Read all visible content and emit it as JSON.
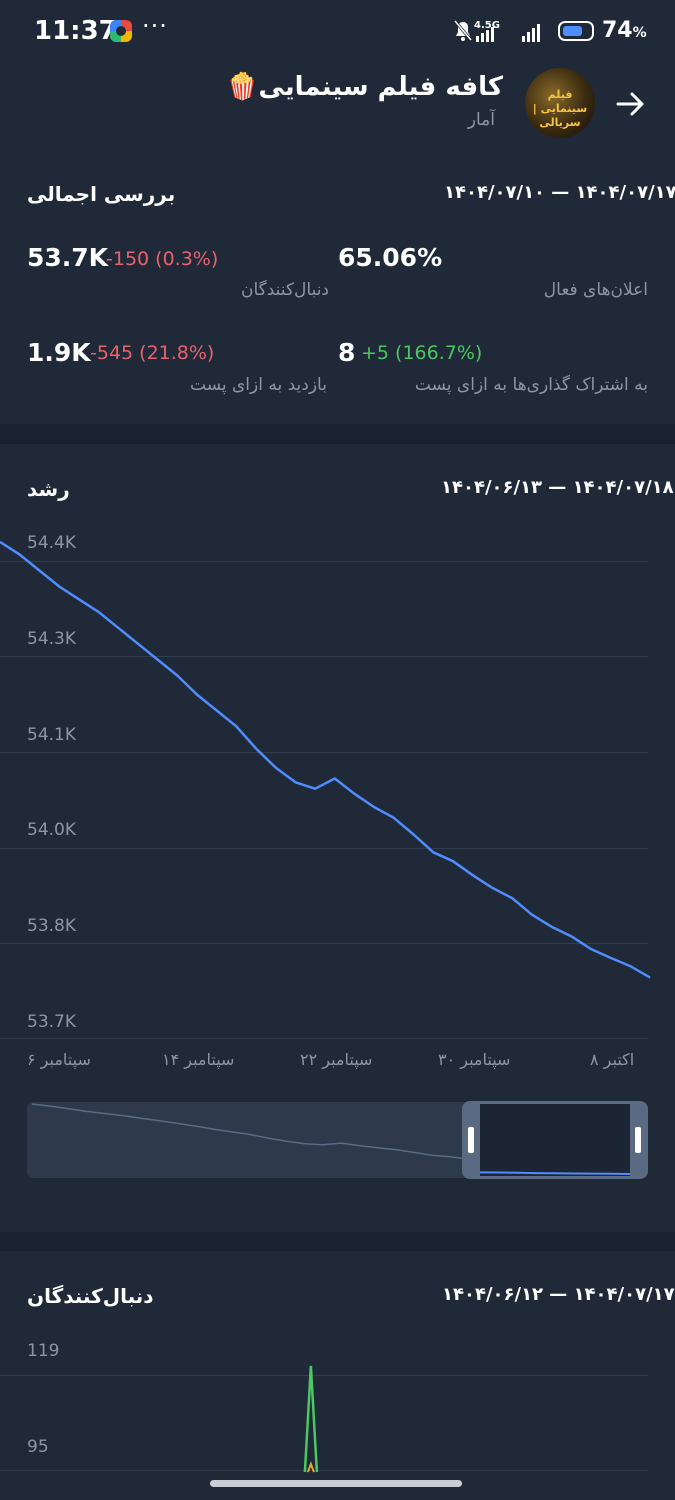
{
  "status_bar": {
    "time": "11:37",
    "dots": "···",
    "network": "4.5G",
    "battery_percent": "74",
    "battery_suffix": "%",
    "battery_level": 0.74
  },
  "header": {
    "channel_name": "کافه فیلم سینمایی",
    "channel_emoji": "🍿",
    "subtitle": "آمار",
    "avatar_text": "فیلم سینمایی | سریالی",
    "icons": [
      "back-arrow-icon"
    ]
  },
  "overview": {
    "title": "بررسی اجمالی",
    "date_range": "۱۴۰۴/۰۷/۱۰ — ۱۴۰۴/۰۷/۱۷",
    "followers": {
      "value": "53.7K",
      "delta": "-150 (0.3%)",
      "label": "دنبال‌کنندگان"
    },
    "notifications": {
      "value": "65.06%",
      "label": "اعلان‌های فعال"
    },
    "views_per_post": {
      "value": "1.9K",
      "delta": "-545 (21.8%)",
      "label": "بازدید به ازای پست"
    },
    "shares_per_post": {
      "value": "8",
      "delta": "+5 (166.7%)",
      "label": "به اشتراک گذاری‌ها به ازای پست"
    }
  },
  "growth": {
    "title": "رشد",
    "date_range": "۱۴۰۴/۰۶/۱۳ — ۱۴۰۴/۰۷/۱۸",
    "y_ticks": [
      "54.4K",
      "54.3K",
      "54.1K",
      "54.0K",
      "53.8K",
      "53.7K"
    ],
    "x_ticks": [
      "سپتامبر ۶",
      "سپتامبر ۱۴",
      "سپتامبر ۲۲",
      "سپتامبر ۳۰",
      "اکتبر ۸"
    ]
  },
  "followers_section": {
    "title": "دنبال‌کنندگان",
    "date_range": "۱۴۰۴/۰۶/۱۲ — ۱۴۰۴/۰۷/۱۷",
    "y_ticks": [
      "119",
      "95"
    ]
  },
  "colors": {
    "background": "#1a2230",
    "card": "#1f2937",
    "accent_line": "#4f8dff",
    "negative": "#e8626e",
    "positive": "#4cc764",
    "muted": "#8b97a8"
  },
  "chart_data": [
    {
      "type": "line",
      "title": "رشد",
      "ylim": [
        53700,
        54420
      ],
      "y_ticks": [
        54400,
        54250,
        54100,
        53950,
        53800,
        53650
      ],
      "grid": true,
      "series": [
        {
          "values": [
            54430,
            54410,
            54385,
            54360,
            54340,
            54320,
            54295,
            54270,
            54245,
            54220,
            54190,
            54165,
            54140,
            54105,
            54075,
            54052,
            54042,
            54058,
            54034,
            54013,
            53996,
            53970,
            53942,
            53928,
            53906,
            53886,
            53870,
            53844,
            53825,
            53810,
            53790,
            53776,
            53763,
            53745
          ]
        }
      ]
    },
    {
      "type": "line",
      "title": "دنبال‌کنندگان",
      "ylim": [
        95,
        119
      ],
      "grid": true,
      "series": [
        {
          "values": [
            0,
            0,
            0,
            0,
            0,
            0,
            0,
            0,
            0,
            0,
            0,
            0,
            0,
            0,
            0,
            0,
            120,
            0,
            0,
            0,
            0,
            0,
            0,
            0,
            0,
            0,
            0,
            0,
            0,
            0,
            0,
            0,
            0,
            0,
            0,
            0
          ]
        }
      ]
    }
  ]
}
